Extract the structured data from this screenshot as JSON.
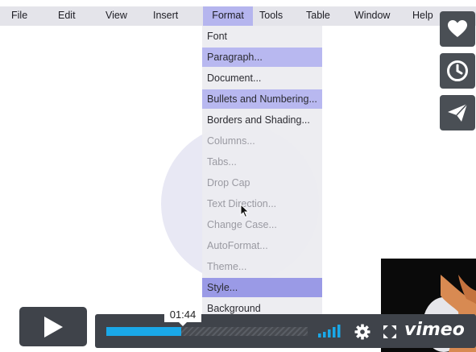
{
  "menubar": {
    "items": [
      "File",
      "Edit",
      "View",
      "Insert",
      "Format",
      "Tools",
      "Table",
      "Window",
      "Help"
    ],
    "active": "Format"
  },
  "format_menu": {
    "items": [
      {
        "label": "Font",
        "enabled": true,
        "highlight": false
      },
      {
        "label": "Paragraph...",
        "enabled": true,
        "highlight": true
      },
      {
        "label": "Document...",
        "enabled": true,
        "highlight": false
      },
      {
        "label": "Bullets and Numbering...",
        "enabled": true,
        "highlight": true
      },
      {
        "label": "Borders and Shading...",
        "enabled": true,
        "highlight": false
      },
      {
        "label": "Columns...",
        "enabled": false,
        "highlight": false
      },
      {
        "label": "Tabs...",
        "enabled": false,
        "highlight": false
      },
      {
        "label": "Drop Cap",
        "enabled": false,
        "highlight": false
      },
      {
        "label": "Text Direction...",
        "enabled": false,
        "highlight": false
      },
      {
        "label": "Change Case...",
        "enabled": false,
        "highlight": false
      },
      {
        "label": "AutoFormat...",
        "enabled": false,
        "highlight": false
      },
      {
        "label": "Theme...",
        "enabled": false,
        "highlight": false
      },
      {
        "label": "Style...",
        "enabled": true,
        "highlight": true,
        "strong": true
      },
      {
        "label": "Background",
        "enabled": true,
        "highlight": false
      }
    ]
  },
  "side_buttons": [
    {
      "icon": "heart-icon",
      "name": "like-button"
    },
    {
      "icon": "clock-icon",
      "name": "watch-later-button"
    },
    {
      "icon": "paper-plane-icon",
      "name": "share-button"
    }
  ],
  "player": {
    "current_time": "01:44",
    "progress_fraction": 0.37,
    "logo": "vimeo",
    "accent_color": "#1aa8e8"
  }
}
